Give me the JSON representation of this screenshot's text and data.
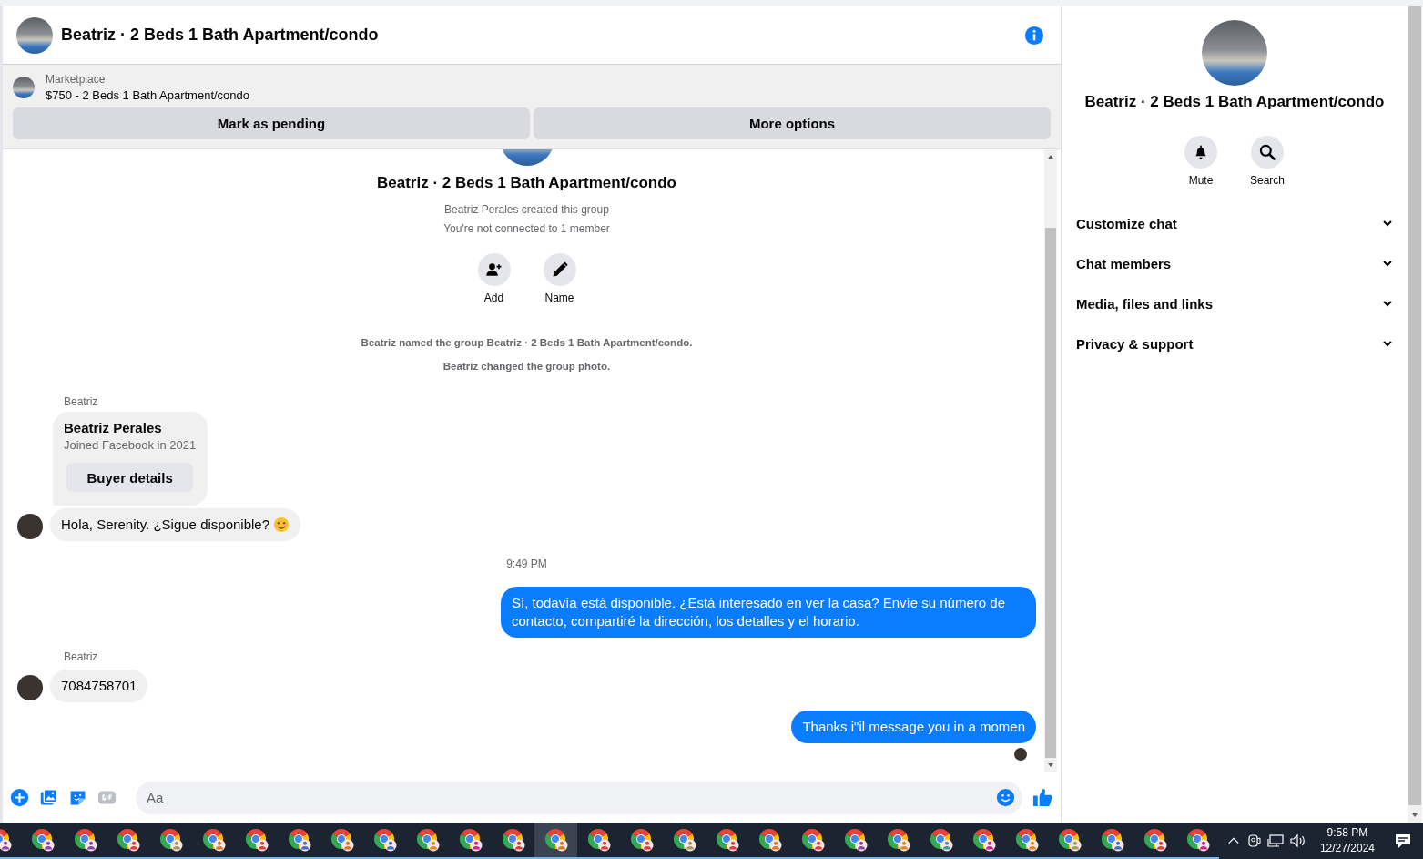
{
  "header": {
    "title": "Beatriz · 2 Beds 1 Bath Apartment/condo"
  },
  "listing": {
    "source": "Marketplace",
    "title": "$750 - 2 Beds 1 Bath Apartment/condo",
    "actions": [
      "Mark as pending",
      "More options"
    ]
  },
  "intro": {
    "title": "Beatriz · 2 Beds 1 Bath Apartment/condo",
    "lines": [
      "Beatriz Perales created this group",
      "You're not connected to 1 member"
    ],
    "actions": [
      {
        "kind": "add",
        "label": "Add"
      },
      {
        "kind": "name",
        "label": "Name"
      }
    ],
    "events": [
      "Beatriz named the group Beatriz · 2 Beds 1 Bath Apartment/condo.",
      "Beatriz changed the group photo."
    ]
  },
  "messages": [
    {
      "kind": "sender",
      "text": "Beatriz"
    },
    {
      "kind": "card",
      "name": "Beatriz Perales",
      "subtitle": "Joined Facebook in 2021",
      "button": "Buyer details"
    },
    {
      "kind": "incoming",
      "text": "Hola, Serenity. ¿Sigue disponible?",
      "smiley": true
    },
    {
      "kind": "time",
      "text": "9:49 PM"
    },
    {
      "kind": "outgoing",
      "text": "Sí, todavía está disponible. ¿Está interesado en ver la casa? Envíe su número de contacto, compartiré la dirección, los detalles y el horario."
    },
    {
      "kind": "sender",
      "text": "Beatriz"
    },
    {
      "kind": "incoming",
      "text": "7084758701",
      "smiley": false
    },
    {
      "kind": "outgoing",
      "text": "Thanks i\"il message you in a momen"
    },
    {
      "kind": "seen"
    }
  ],
  "composer": {
    "placeholder": "Aa"
  },
  "details": {
    "title": "Beatriz · 2 Beds 1 Bath Apartment/condo",
    "actions": [
      {
        "kind": "mute",
        "label": "Mute"
      },
      {
        "kind": "search",
        "label": "Search"
      }
    ],
    "sections": [
      {
        "label": "Customize chat",
        "expanded": false
      },
      {
        "label": "Chat members",
        "expanded": false
      },
      {
        "label": "Media, files and links",
        "expanded": false
      },
      {
        "label": "Privacy & support",
        "expanded": false
      }
    ]
  },
  "taskbar": {
    "apps": [
      {
        "color": "#8e44ad",
        "selected": false
      },
      {
        "color": "#8e44ad",
        "selected": false
      },
      {
        "color": "#8e44ad",
        "selected": false
      },
      {
        "color": "#e53935",
        "selected": false
      },
      {
        "color": "#a89a5c",
        "selected": false
      },
      {
        "color": "#e8711c",
        "selected": false
      },
      {
        "color": "#e53935",
        "selected": false
      },
      {
        "color": "#3f6fc4",
        "selected": false
      },
      {
        "color": "#e8711c",
        "selected": false
      },
      {
        "color": "#3f6fc4",
        "selected": false
      },
      {
        "color": "#e0891c",
        "selected": false
      },
      {
        "color": "#d81b8c",
        "selected": false
      },
      {
        "color": "#e53935",
        "selected": false
      },
      {
        "color": "#e8711c",
        "selected": true
      },
      {
        "color": "#e53935",
        "selected": false
      },
      {
        "color": "#e53935",
        "selected": false
      },
      {
        "color": "#a89a5c",
        "selected": false
      },
      {
        "color": "#e53935",
        "selected": false
      },
      {
        "color": "#e8711c",
        "selected": false
      },
      {
        "color": "#e53935",
        "selected": false
      },
      {
        "color": "#8e44ad",
        "selected": false
      },
      {
        "color": "#e0891c",
        "selected": false
      },
      {
        "color": "#3a9a9a",
        "selected": false
      },
      {
        "color": "#d81b8c",
        "selected": false
      },
      {
        "color": "#e0891c",
        "selected": false
      },
      {
        "color": "#a89a5c",
        "selected": false
      },
      {
        "color": "#3f6fc4",
        "selected": false
      },
      {
        "color": "#e53935",
        "selected": false
      },
      {
        "color": "#d81b8c",
        "selected": false
      }
    ],
    "time": "9:58 PM",
    "date": "12/27/2024"
  }
}
